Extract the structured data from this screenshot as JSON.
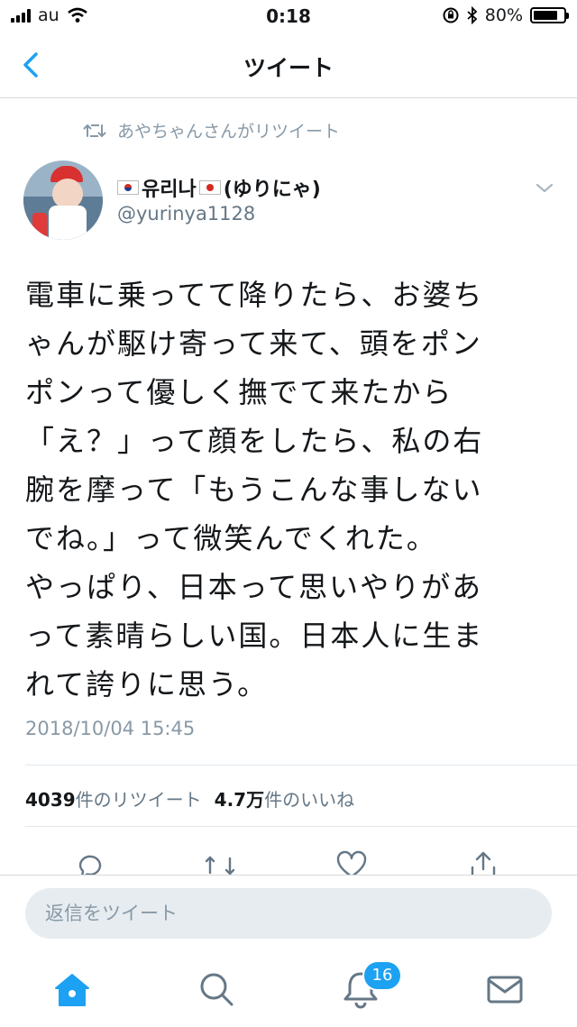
{
  "status_bar": {
    "carrier": "au",
    "time": "0:18",
    "battery_percent": "80%",
    "battery_level": 0.8
  },
  "nav": {
    "title": "ツイート"
  },
  "retweet_context": "あやちゃんさんがリツイート",
  "user": {
    "name": "유리나",
    "name_suffix": "(ゆりにゃ)",
    "handle": "@yurinya1128"
  },
  "tweet": {
    "text": "電車に乗ってて降りたら、お婆ち\nゃんが駆け寄って来て、頭をポン\nポンって優しく撫でて来たから\n「え？」って顔をしたら、私の右\n腕を摩って「もうこんな事しない\nでね。」って微笑んでくれた。\nやっぱり、日本って思いやりがあ\nって素晴らしい国。日本人に生ま\nれて誇りに思う。",
    "timestamp": "2018/10/04 15:45"
  },
  "stats": {
    "retweets_count": "4039",
    "retweets_label": "件のリツイート",
    "likes_count": "4.7万",
    "likes_label": "件のいいね"
  },
  "reply": {
    "placeholder": "返信をツイート"
  },
  "tab_bar": {
    "notifications_badge": "16"
  },
  "colors": {
    "accent": "#1da1f2",
    "text": "#14171a",
    "secondary": "#657786",
    "muted": "#8899a6"
  }
}
